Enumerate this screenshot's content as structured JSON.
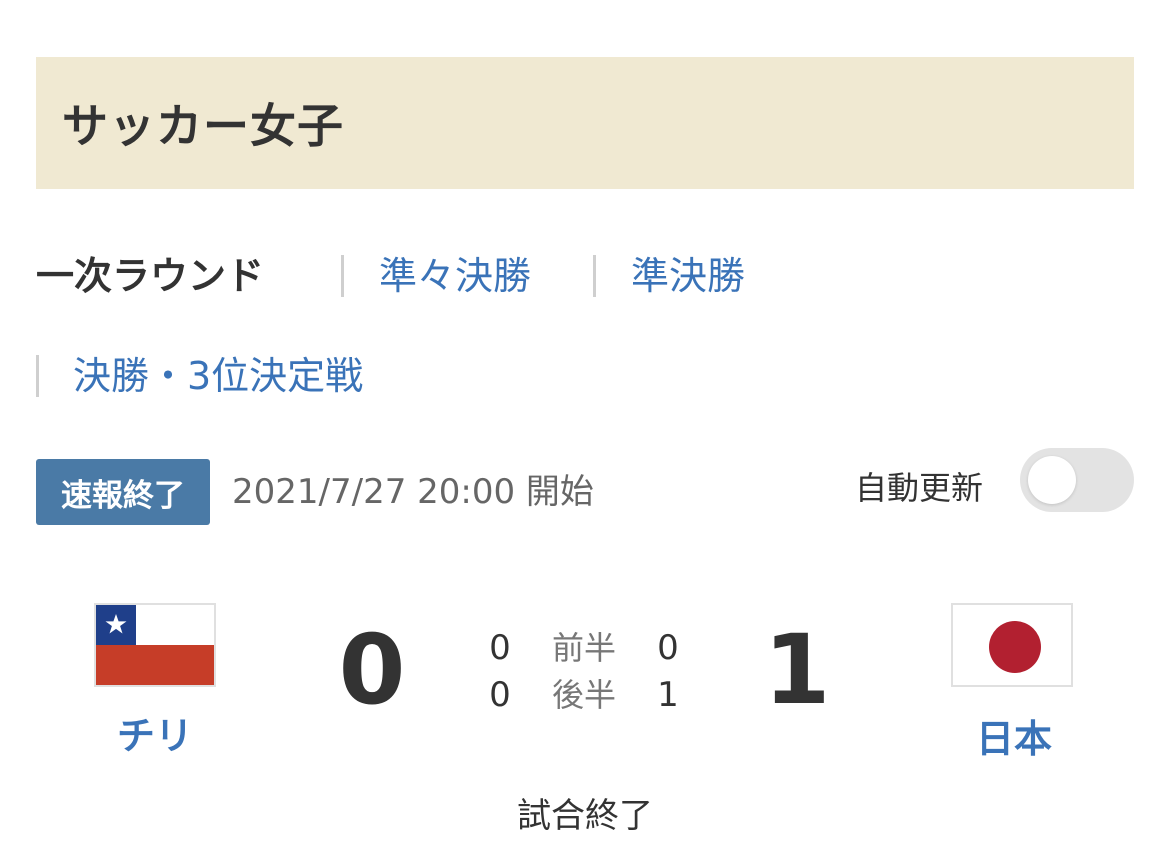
{
  "header": {
    "title": "サッカー女子"
  },
  "rounds": {
    "active": "一次ラウンド",
    "quarterfinal": "準々決勝",
    "semifinal": "準決勝",
    "final": "決勝・3位決定戦"
  },
  "match": {
    "status_badge": "速報終了",
    "start_time": "2021/7/27 20:00 開始",
    "auto_update_label": "自動更新",
    "auto_update_on": false,
    "home": {
      "name": "チリ",
      "score": "0",
      "first_half": "0",
      "second_half": "0"
    },
    "away": {
      "name": "日本",
      "score": "1",
      "first_half": "0",
      "second_half": "1"
    },
    "first_half_label": "前半",
    "second_half_label": "後半",
    "result": "試合終了"
  },
  "colors": {
    "title_bg": "#f0e9d2",
    "link": "#3a73b8",
    "badge_bg": "#4a7aa6",
    "chile_blue": "#1f3f8a",
    "chile_red": "#c63d28",
    "japan_red": "#b22030"
  }
}
